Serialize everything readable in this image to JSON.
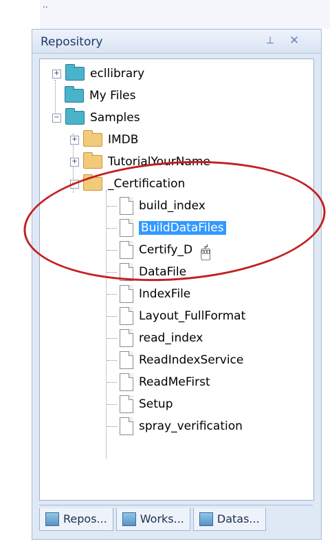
{
  "top_text": "..",
  "panel": {
    "title": "Repository",
    "pin": "⊥",
    "close": "✕"
  },
  "tree": {
    "items": [
      {
        "label": "ecllibrary"
      },
      {
        "label": "My Files"
      },
      {
        "label": "Samples"
      },
      {
        "label": "IMDB"
      },
      {
        "label": "TutorialYourName"
      },
      {
        "label": "_Certification"
      },
      {
        "label": "build_index"
      },
      {
        "label": "BuildDataFiles"
      },
      {
        "label": "Certify_D"
      },
      {
        "label": "DataFile"
      },
      {
        "label": "IndexFile"
      },
      {
        "label": "Layout_FullFormat"
      },
      {
        "label": "read_index"
      },
      {
        "label": "ReadIndexService"
      },
      {
        "label": "ReadMeFirst"
      },
      {
        "label": "Setup"
      },
      {
        "label": "spray_verification"
      }
    ]
  },
  "tabs": [
    {
      "label": "Repos..."
    },
    {
      "label": "Works..."
    },
    {
      "label": "Datas..."
    }
  ]
}
